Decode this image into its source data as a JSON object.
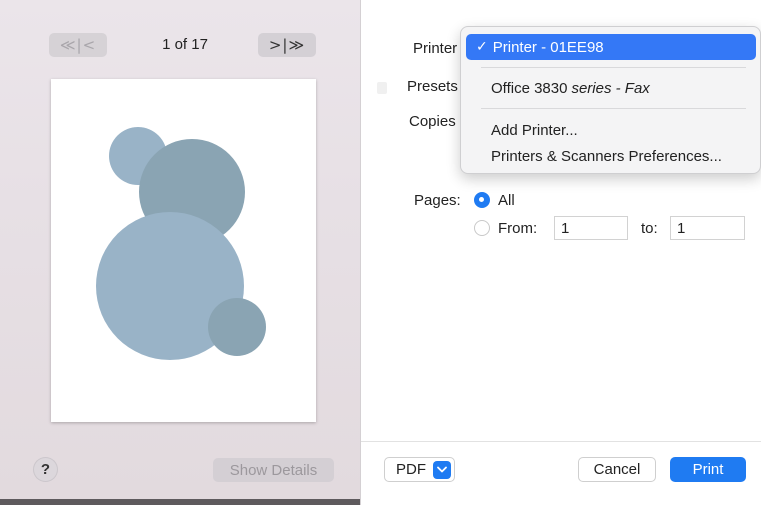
{
  "navigation": {
    "first_prev_glyph": "≪|<",
    "next_last_glyph": ">|≫",
    "page_indicator": "1 of 17"
  },
  "preview": {
    "circles_fill": [
      "#99b3c7",
      "#8aa4b3",
      "#99b3c7",
      "#8aa4b3"
    ]
  },
  "left_footer": {
    "help_label": "?",
    "show_details_label": "Show Details"
  },
  "settings": {
    "printer_label": "Printer",
    "presets_label": "Presets",
    "copies_label": "Copies",
    "pages_label": "Pages:",
    "all_label": "All",
    "from_label": "From:",
    "from_value": "1",
    "to_label": "to:",
    "to_value": "1"
  },
  "printer_menu": {
    "items": [
      {
        "label": "Printer - 01EE98",
        "selected": true,
        "check": "✓"
      },
      {
        "label": "Office 3830",
        "suffix": "series - Fax",
        "selected": false
      },
      {
        "label": "Add Printer...",
        "selected": false
      },
      {
        "label": "Printers & Scanners Preferences...",
        "selected": false
      }
    ]
  },
  "footer": {
    "pdf_label": "PDF",
    "cancel_label": "Cancel",
    "print_label": "Print"
  },
  "colors": {
    "accent": "#1f7bf2",
    "menu_highlight": "#3478f6"
  }
}
